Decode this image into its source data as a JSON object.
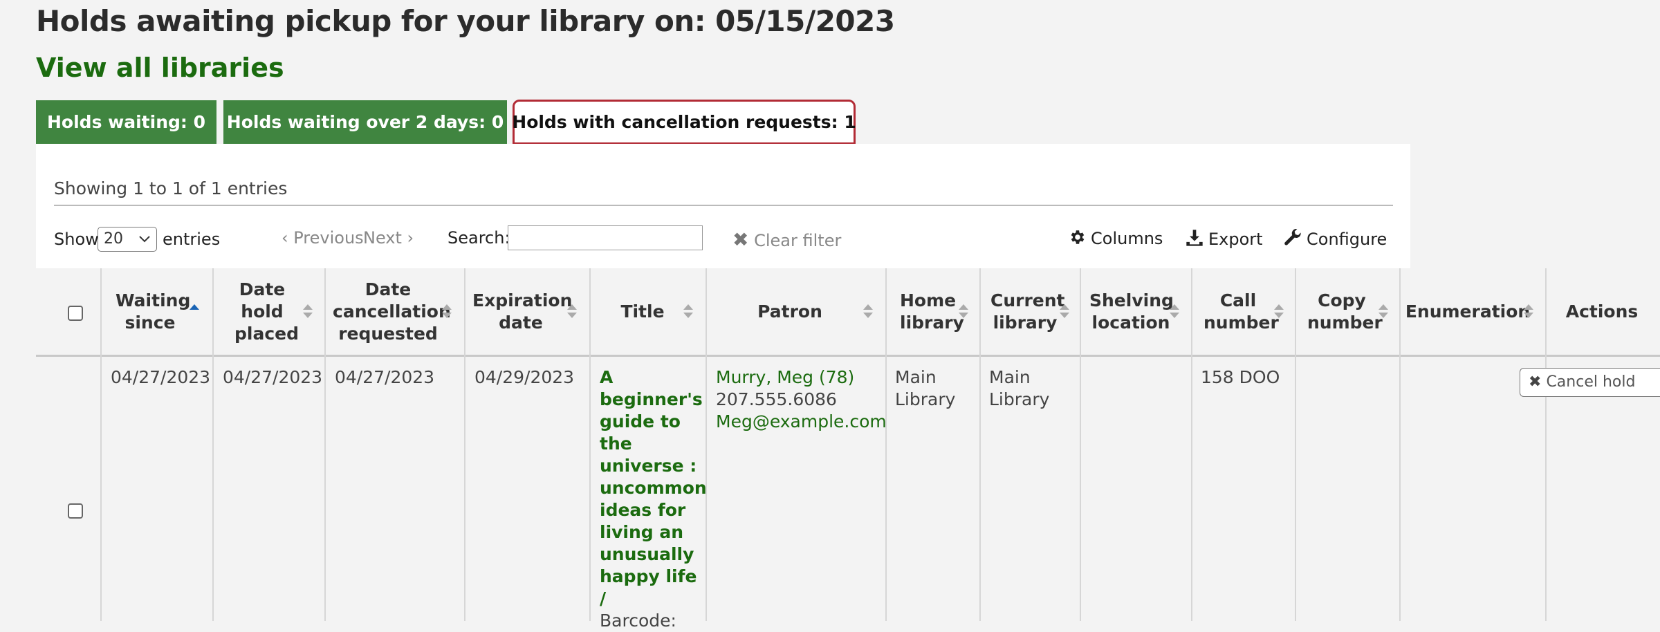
{
  "page": {
    "title": "Holds awaiting pickup for your library on: 05/15/2023",
    "view_all": "View all libraries"
  },
  "tabs": [
    {
      "label": "Holds waiting: 0"
    },
    {
      "label": "Holds waiting over 2 days: 0"
    },
    {
      "label": "Holds with cancellation requests: 1"
    }
  ],
  "toolbar": {
    "info": "Showing 1 to 1 of 1 entries",
    "show_label": "Show",
    "page_size": "20",
    "entries_label": "entries",
    "previous": "Previous",
    "next": "Next",
    "search_label": "Search:",
    "search_value": "",
    "clear_filter": "Clear filter",
    "columns": "Columns",
    "export": "Export",
    "configure": "Configure"
  },
  "table": {
    "columns": [
      {
        "label": "Waiting since"
      },
      {
        "label": "Date hold placed"
      },
      {
        "label": "Date cancellation requested"
      },
      {
        "label": "Expiration date"
      },
      {
        "label": "Title"
      },
      {
        "label": "Patron"
      },
      {
        "label": "Home library"
      },
      {
        "label": "Current library"
      },
      {
        "label": "Shelving location"
      },
      {
        "label": "Call number"
      },
      {
        "label": "Copy number"
      },
      {
        "label": "Enumeration"
      },
      {
        "label": "Actions"
      }
    ],
    "rows": [
      {
        "waiting_since": "04/27/2023",
        "date_placed": "04/27/2023",
        "date_cancel_requested": "04/27/2023",
        "expiration": "04/29/2023",
        "title": "A beginner's guide to the universe : uncommon ideas for living an unusually happy life /",
        "barcode_label": "Barcode:",
        "patron_name": "Murry, Meg (78)",
        "patron_phone": "207.555.6086",
        "patron_email": "Meg@example.com",
        "home_library": "Main Library",
        "current_library": "Main Library",
        "shelving_location": "",
        "call_number": "158 DOO",
        "copy_number": "",
        "enumeration": "",
        "action": "Cancel hold"
      }
    ]
  }
}
